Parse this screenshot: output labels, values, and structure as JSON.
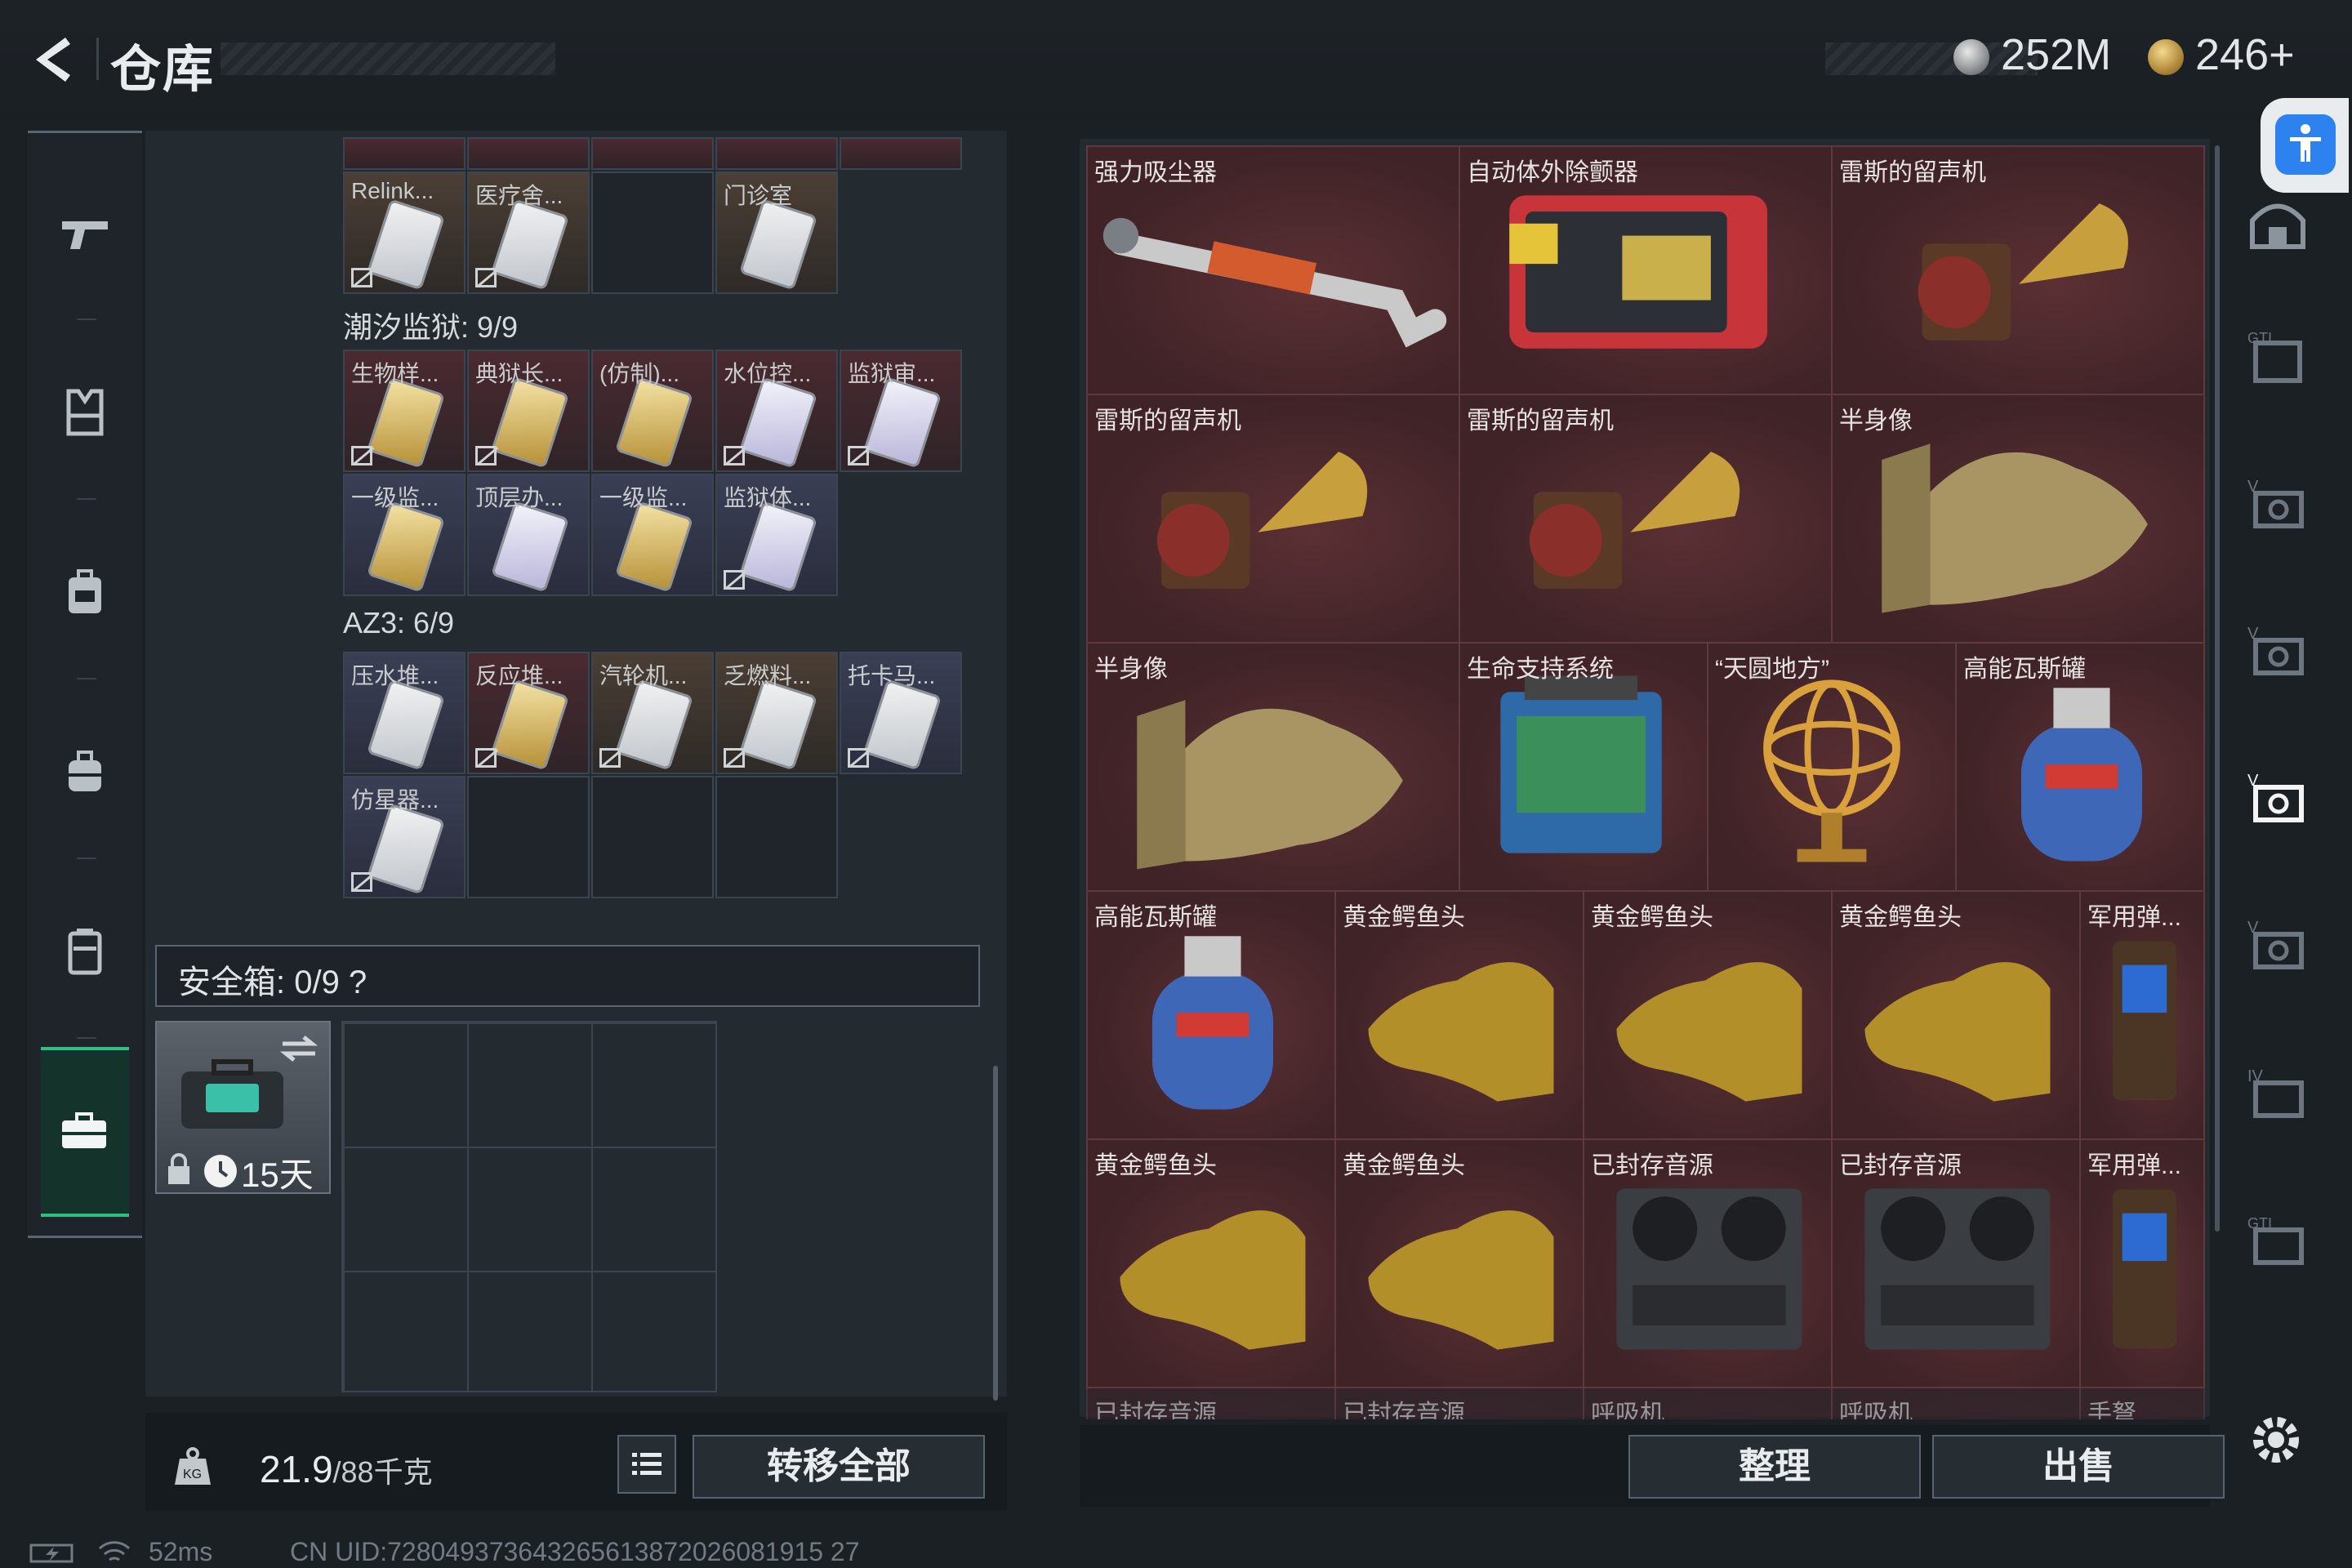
{
  "header": {
    "title": "仓库",
    "currency1": "252M",
    "currency2": "246+"
  },
  "left_nav": {
    "items": [
      "pistol-icon",
      "armor-vest-icon",
      "backpack-icon",
      "bag-icon",
      "case-icon",
      "briefcase-icon"
    ]
  },
  "storage": {
    "top_row": [
      {
        "label": "Relink..."
      },
      {
        "label": "医疗舍..."
      },
      {
        "label": ""
      },
      {
        "label": "门诊室"
      }
    ],
    "section1_title": "潮汐监狱: 9/9",
    "section1_row1": [
      {
        "label": "生物样..."
      },
      {
        "label": "典狱长..."
      },
      {
        "label": "(仿制)..."
      },
      {
        "label": "水位控..."
      },
      {
        "label": "监狱审..."
      }
    ],
    "section1_row2": [
      {
        "label": "一级监..."
      },
      {
        "label": "顶层办..."
      },
      {
        "label": "一级监..."
      },
      {
        "label": "监狱体..."
      }
    ],
    "section2_title": "AZ3: 6/9",
    "section2_row1": [
      {
        "label": "压水堆..."
      },
      {
        "label": "反应堆..."
      },
      {
        "label": "汽轮机..."
      },
      {
        "label": "乏燃料..."
      },
      {
        "label": "托卡马..."
      }
    ],
    "section2_row2": [
      {
        "label": "仿星器..."
      }
    ],
    "safebox_label": "安全箱: 0/9 ?",
    "safebox_days": "15天"
  },
  "footer": {
    "weight_current": "21.9",
    "weight_max": "/88千克",
    "transfer_all": "转移全部",
    "organize": "整理",
    "sell": "出售",
    "status": "52ms",
    "uid": "CN UID:728049373643265613872026081915 27"
  },
  "inventory": {
    "row1": [
      "强力吸尘器",
      "自动体外除颤器",
      "雷斯的留声机"
    ],
    "row2": [
      "雷斯的留声机",
      "雷斯的留声机",
      "半身像"
    ],
    "row3": [
      "半身像",
      "生命支持系统",
      "“天圆地方”",
      "高能瓦斯罐"
    ],
    "row4": [
      "高能瓦斯罐",
      "黄金鳄鱼头",
      "黄金鳄鱼头",
      "黄金鳄鱼头",
      "军用弹..."
    ],
    "row5": [
      "黄金鳄鱼头",
      "黄金鳄鱼头",
      "已封存音源",
      "已封存音源",
      "军用弹..."
    ],
    "row6": [
      "已封存音源",
      "已封存音源",
      "呼吸机",
      "呼吸机",
      "手弩"
    ]
  }
}
